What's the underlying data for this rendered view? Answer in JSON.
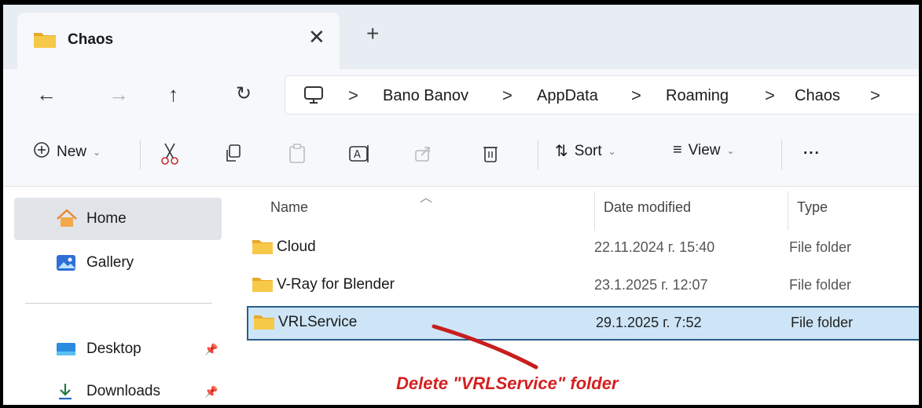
{
  "tab": {
    "title": "Chaos",
    "close": "✕",
    "add": "+"
  },
  "nav": {
    "back": "←",
    "forward": "→",
    "up": "↑",
    "refresh": "↻"
  },
  "breadcrumb": [
    {
      "label": "Bano Banov"
    },
    {
      "label": "AppData"
    },
    {
      "label": "Roaming"
    },
    {
      "label": "Chaos"
    }
  ],
  "separator": ">",
  "toolbar": {
    "new_label": "New",
    "sort_label": "Sort",
    "view_label": "View",
    "more_label": "..."
  },
  "sidebar": {
    "items": [
      {
        "label": "Home"
      },
      {
        "label": "Gallery"
      },
      {
        "label": "Desktop"
      },
      {
        "label": "Downloads"
      }
    ]
  },
  "columns": {
    "name": "Name",
    "date": "Date modified",
    "type": "Type"
  },
  "rows": [
    {
      "name": "Cloud",
      "date": "22.11.2024 г. 15:40",
      "type": "File folder"
    },
    {
      "name": "V-Ray for Blender",
      "date": "23.1.2025 г. 12:07",
      "type": "File folder"
    },
    {
      "name": "VRLService",
      "date": "29.1.2025 г. 7:52",
      "type": "File folder"
    }
  ],
  "annotation": {
    "text": "Delete \"VRLService\" folder",
    "color": "#d42020"
  },
  "colors": {
    "selection": "#cde5f7",
    "selection_border": "#2c5e8c",
    "folder": "#f7c948"
  }
}
